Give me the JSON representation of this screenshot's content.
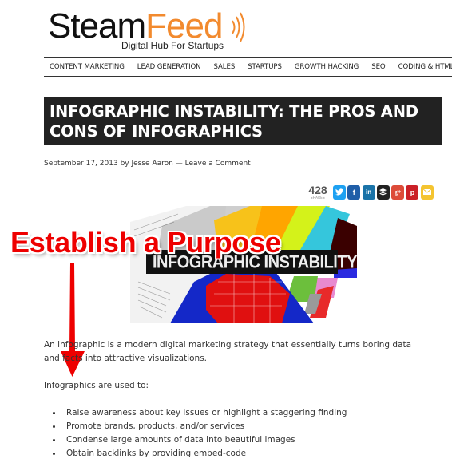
{
  "site": {
    "logo_part1": "Steam",
    "logo_part2": "Feed",
    "tagline": "Digital Hub For Startups",
    "brand_color": "#f28a2e"
  },
  "nav": {
    "items": [
      {
        "label": "CONTENT MARKETING"
      },
      {
        "label": "LEAD GENERATION"
      },
      {
        "label": "SALES"
      },
      {
        "label": "STARTUPS"
      },
      {
        "label": "GROWTH HACKING"
      },
      {
        "label": "SEO"
      },
      {
        "label": "CODING & HTML"
      }
    ]
  },
  "article": {
    "title": "INFOGRAPHIC INSTABILITY: THE PROS AND CONS OF INFOGRAPHICS",
    "date": "September 17, 2013",
    "by": "by",
    "author": "Jesse Aaron",
    "separator": "—",
    "comment_link": "Leave a Comment",
    "hero_caption": "INFOGRAPHIC INSTABILITY",
    "paragraph1": "An infographic is a modern digital marketing strategy that essentially turns boring data and facts into attractive visualizations.",
    "paragraph2": "Infographics are used to:",
    "bullets": [
      "Raise awareness about key issues or highlight a staggering finding",
      "Promote brands, products, and/or services",
      "Condense large amounts of data into beautiful images",
      "Obtain backlinks by providing embed-code"
    ]
  },
  "share": {
    "count": "428",
    "count_label": "SHARES",
    "buttons": [
      {
        "name": "twitter",
        "glyph": "t",
        "color": "#1da1f2"
      },
      {
        "name": "facebook",
        "glyph": "f",
        "color": "#1f5ea8"
      },
      {
        "name": "linkedin",
        "glyph": "in",
        "color": "#1a73a8"
      },
      {
        "name": "buffer",
        "glyph": "≡",
        "color": "#222222"
      },
      {
        "name": "google-plus",
        "glyph": "g+",
        "color": "#dd4b39"
      },
      {
        "name": "pinterest",
        "glyph": "p",
        "color": "#cb2027"
      },
      {
        "name": "email",
        "glyph": "✉",
        "color": "#f4c430"
      }
    ]
  },
  "annotation": {
    "label": "Establish a Purpose",
    "color": "#ee0000"
  }
}
